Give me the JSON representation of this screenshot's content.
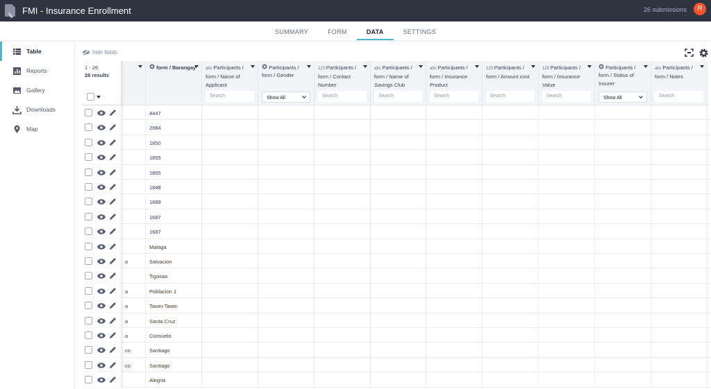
{
  "app": {
    "title": "FMI - Insurance Enrollment",
    "submissions": "26 submissions",
    "avatar_letter": "R",
    "accent": "#4fb5cf"
  },
  "tabs": [
    {
      "label": "SUMMARY"
    },
    {
      "label": "FORM"
    },
    {
      "label": "DATA",
      "active": true
    },
    {
      "label": "SETTINGS"
    }
  ],
  "sidebar": [
    {
      "label": "Table",
      "icon": "table-icon"
    },
    {
      "label": "Reports",
      "icon": "chart-icon"
    },
    {
      "label": "Gallery",
      "icon": "image-icon"
    },
    {
      "label": "Downloads",
      "icon": "download-icon"
    },
    {
      "label": "Map",
      "icon": "map-pin-icon"
    }
  ],
  "toolbar": {
    "hide_fields": "hide fields"
  },
  "table": {
    "range": "1 - 26",
    "results": "26 results",
    "columns": [
      {
        "type": "",
        "label": "",
        "filter": "none"
      },
      {
        "type": "select",
        "label": "form / Barangay",
        "filter": "none"
      },
      {
        "type": "abc",
        "label": "Participants / form / Name of Applicant",
        "filter": "search"
      },
      {
        "type": "select",
        "label": "Participants / form / Gender",
        "filter": "select"
      },
      {
        "type": "123",
        "label": "Participants / form / Contact Number",
        "filter": "search"
      },
      {
        "type": "abc",
        "label": "Participants / form / Name of Savings Club",
        "filter": "search"
      },
      {
        "type": "abc",
        "label": "Participants / form / Insurance Product",
        "filter": "search"
      },
      {
        "type": "123",
        "label": "Participants / form / Amount cost",
        "filter": "search"
      },
      {
        "type": "123",
        "label": "Participants / form / Insurance Value",
        "filter": "search"
      },
      {
        "type": "select",
        "label": "Participants / form / Status of Insurer",
        "filter": "select"
      },
      {
        "type": "abc",
        "label": "Participants / form / Notes",
        "filter": "search"
      }
    ],
    "search_placeholder": "Search",
    "select_value": "Show All",
    "rows": [
      [
        "",
        "4447"
      ],
      [
        "",
        "2984"
      ],
      [
        "",
        "1850"
      ],
      [
        "",
        "1855"
      ],
      [
        "",
        "1855"
      ],
      [
        "",
        "1848"
      ],
      [
        "",
        "1689"
      ],
      [
        "",
        "1687"
      ],
      [
        "",
        "1687"
      ],
      [
        "",
        "Malaga"
      ],
      [
        "o",
        "Salvacion"
      ],
      [
        "",
        "Tigasao"
      ],
      [
        "a",
        "Poblacion 1"
      ],
      [
        "a",
        "Tawin-Tawin"
      ],
      [
        "a",
        "Santa Cruz"
      ],
      [
        "a",
        "Consuelo"
      ],
      [
        "co",
        "Santiago"
      ],
      [
        "co",
        "Santiago"
      ],
      [
        "",
        "Alegria"
      ]
    ]
  }
}
